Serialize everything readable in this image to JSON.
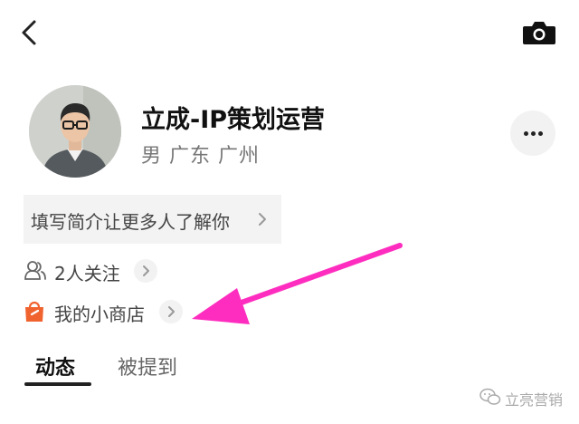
{
  "profile": {
    "name": "立成-IP策划运营",
    "meta": "男 广东 广州"
  },
  "bio": {
    "prompt": "填写简介让更多人了解你"
  },
  "follow": {
    "label": "2人关注"
  },
  "shop": {
    "label": "我的小商店"
  },
  "tabs": [
    {
      "label": "动态",
      "active": true
    },
    {
      "label": "被提到",
      "active": false
    }
  ],
  "watermark": {
    "text": "立亮营销"
  },
  "colors": {
    "annotation_arrow": "#ff2dbf",
    "shop_icon": "#f0632f",
    "chip_bg": "#f2f2f2"
  },
  "icons": [
    "back-arrow-icon",
    "camera-icon",
    "more-dots-icon",
    "chevron-right-icon",
    "people-icon",
    "shop-bag-icon",
    "wechat-icon"
  ]
}
